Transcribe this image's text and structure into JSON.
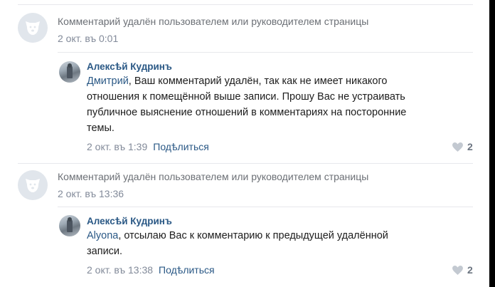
{
  "comments": [
    {
      "deleted_text": "Комментарий удалён пользователем или руководителем страницы",
      "time": "2 окт. въ 0:01",
      "avatar_icon": "dog-avatar-icon",
      "reply": {
        "author": "Алексѣй Кудринъ",
        "mention": "Дмитрий",
        "lines": [
          ", Ваш комментарий удалён, так как не имеет никакого",
          "отношения к помещённой выше записи. Прошу Вас не устраивать",
          "публичное выяснение отношений в комментариях на посторонние",
          "темы."
        ],
        "time": "2 окт. въ 1:39",
        "share_label": "Подѣлиться",
        "likes": "2",
        "like_icon": "heart-icon"
      }
    },
    {
      "deleted_text": "Комментарий удалён пользователем или руководителем страницы",
      "time": "2 окт. въ 13:36",
      "avatar_icon": "dog-avatar-icon",
      "reply": {
        "author": "Алексѣй Кудринъ",
        "mention": "Alyona",
        "lines": [
          ", отсылаю Вас к комментарию к предыдущей удалённой",
          "записи."
        ],
        "time": "2 окт. въ 13:38",
        "share_label": "Подѣлиться",
        "likes": "2",
        "like_icon": "heart-icon"
      }
    }
  ],
  "colors": {
    "link": "#2a5885",
    "meta": "#828a99",
    "divider": "#e7e8ec",
    "avatar_bg": "#e1e6ec"
  }
}
